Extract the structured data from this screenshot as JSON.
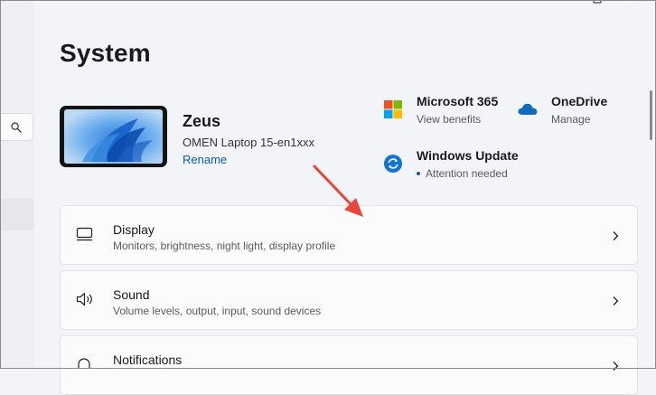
{
  "page": {
    "title": "System"
  },
  "device": {
    "name": "Zeus",
    "model": "OMEN Laptop 15-en1xxx",
    "rename_label": "Rename"
  },
  "quick_links": [
    {
      "title": "Microsoft 365",
      "subtitle": "View benefits",
      "icon": "microsoft-365-icon"
    },
    {
      "title": "OneDrive",
      "subtitle": "Manage",
      "icon": "onedrive-cloud-icon"
    },
    {
      "title": "Windows Update",
      "subtitle": "Attention needed",
      "icon": "windows-update-icon"
    }
  ],
  "settings": [
    {
      "title": "Display",
      "subtitle": "Monitors, brightness, night light, display profile",
      "icon": "monitor-icon"
    },
    {
      "title": "Sound",
      "subtitle": "Volume levels, output, input, sound devices",
      "icon": "speaker-icon"
    },
    {
      "title": "Notifications",
      "subtitle": "",
      "icon": "bell-icon"
    }
  ],
  "colors": {
    "accent": "#0b5cab",
    "annotation_arrow": "#e8453c",
    "page_background": "#f3f4f7",
    "card_background": "#fbfbfb"
  }
}
